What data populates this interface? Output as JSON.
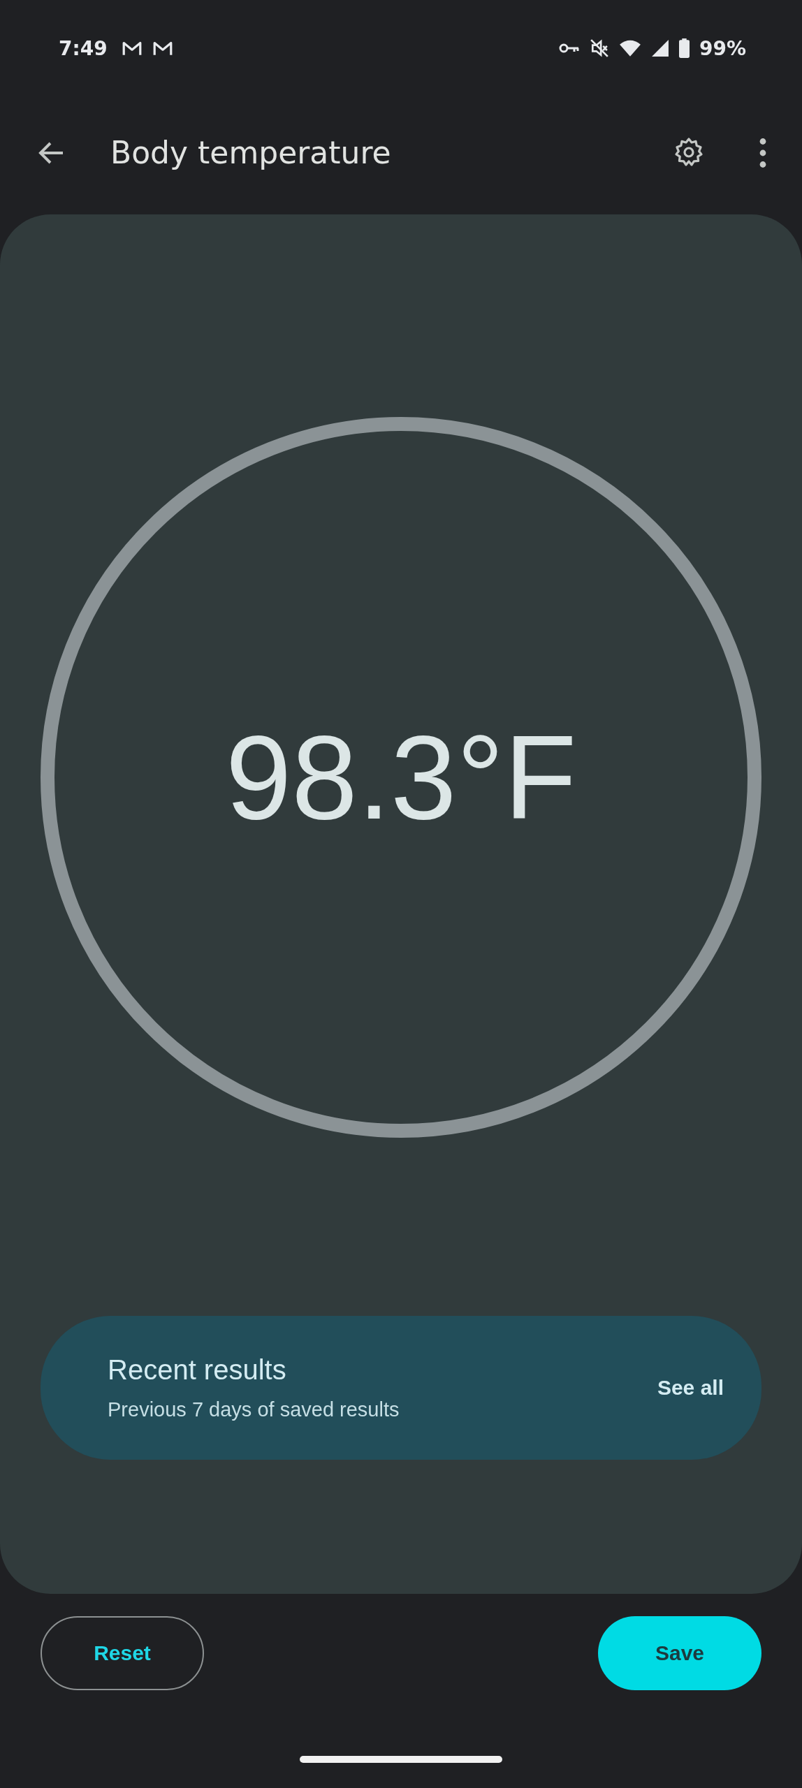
{
  "status_bar": {
    "time": "7:49",
    "battery": "99%"
  },
  "header": {
    "title": "Body temperature"
  },
  "reading": {
    "value": "98.3°F"
  },
  "recent_results": {
    "title": "Recent results",
    "subtitle": "Previous 7 days of saved results",
    "link": "See all"
  },
  "buttons": [
    {
      "label": "Reset",
      "kind": "outlined"
    },
    {
      "label": "Save",
      "kind": "filled"
    }
  ]
}
